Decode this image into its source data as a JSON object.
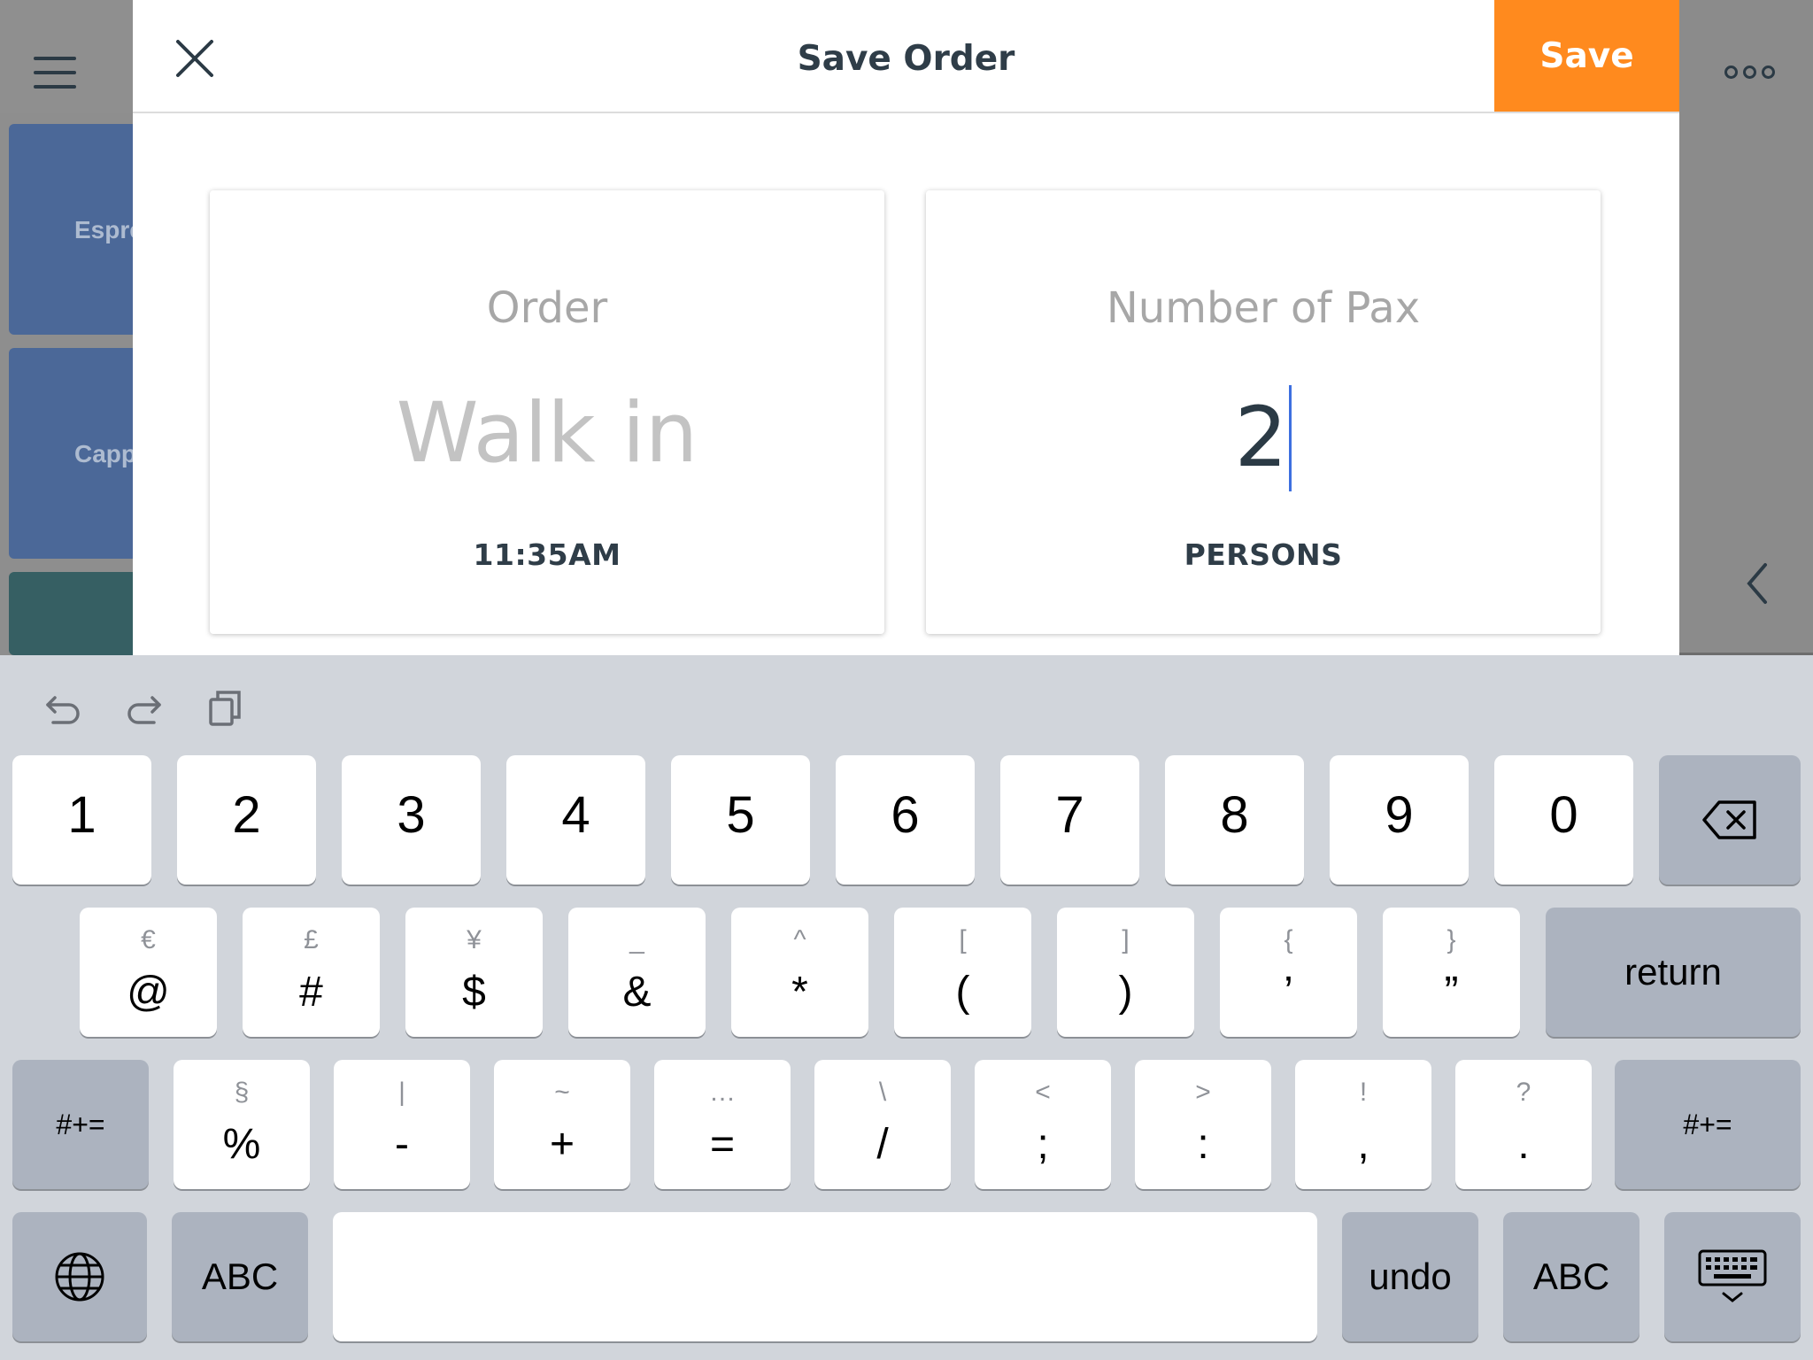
{
  "background": {
    "tiles": [
      "Espre",
      "Cappu",
      ""
    ]
  },
  "header": {
    "title": "Save Order",
    "save_label": "Save"
  },
  "order_card": {
    "label": "Order",
    "value": "Walk in",
    "time": "11:35AM"
  },
  "pax_card": {
    "label": "Number of Pax",
    "value": "2",
    "unit": "PERSONS"
  },
  "colors": {
    "accent": "#ff8a1e",
    "text_dark": "#2f3d48",
    "cursor": "#3d6fe0"
  },
  "keyboard": {
    "row1": [
      "1",
      "2",
      "3",
      "4",
      "5",
      "6",
      "7",
      "8",
      "9",
      "0"
    ],
    "row2": [
      {
        "main": "@",
        "alt": "€"
      },
      {
        "main": "#",
        "alt": "£"
      },
      {
        "main": "$",
        "alt": "¥"
      },
      {
        "main": "&",
        "alt": "_"
      },
      {
        "main": "*",
        "alt": "^"
      },
      {
        "main": "(",
        "alt": "["
      },
      {
        "main": ")",
        "alt": "]"
      },
      {
        "main": "’",
        "alt": "{"
      },
      {
        "main": "”",
        "alt": "}"
      }
    ],
    "row3": [
      {
        "main": "%",
        "alt": "§"
      },
      {
        "main": "-",
        "alt": "|"
      },
      {
        "main": "+",
        "alt": "~"
      },
      {
        "main": "=",
        "alt": "…"
      },
      {
        "main": "/",
        "alt": "\\"
      },
      {
        "main": ";",
        "alt": "<"
      },
      {
        "main": ":",
        "alt": ">"
      },
      {
        "main": ",",
        "alt": "!"
      },
      {
        "main": ".",
        "alt": "?"
      }
    ],
    "return_label": "return",
    "symbols_label": "#+=",
    "abc_label": "ABC",
    "undo_label": "undo",
    "icons": [
      "undo-icon",
      "redo-icon",
      "paste-icon",
      "backspace-icon",
      "globe-icon",
      "keyboard-dismiss-icon"
    ]
  }
}
